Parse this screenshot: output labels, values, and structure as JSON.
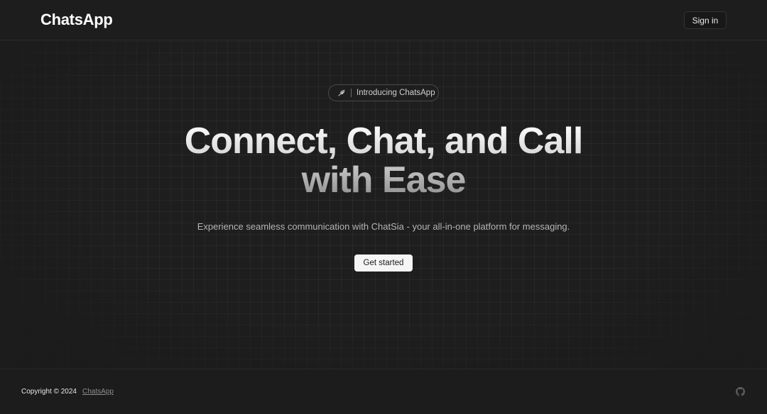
{
  "header": {
    "brand": "ChatsApp",
    "signin_label": "Sign in"
  },
  "hero": {
    "pill_label": "Introducing ChatsApp",
    "pill_icon": "rocket-icon",
    "headline_line1": "Connect, Chat, and Call",
    "headline_line2": "with Ease",
    "subtitle": "Experience seamless communication with ChatSia - your all-in-one platform for messaging.",
    "cta_label": "Get started"
  },
  "footer": {
    "copyright": "Copyright © 2024",
    "link_label": "ChatsApp",
    "github_icon": "github-icon"
  },
  "colors": {
    "background": "#1c1c1c",
    "cta_background": "#f5f5f5",
    "text": "#e8e8e8"
  }
}
